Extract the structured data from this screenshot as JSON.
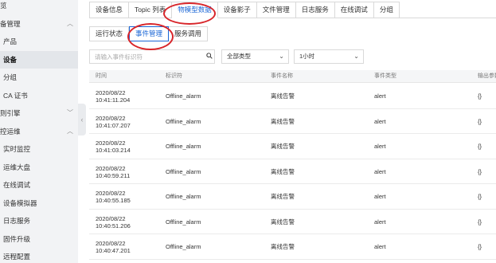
{
  "sidebar": {
    "items": [
      {
        "label": "览",
        "level": "l1",
        "chevron": ""
      },
      {
        "label": "备管理",
        "level": "l1",
        "chevron": "^"
      },
      {
        "label": "产品",
        "level": "l2",
        "chevron": ""
      },
      {
        "label": "设备",
        "level": "l2",
        "chevron": "",
        "active": true
      },
      {
        "label": "分组",
        "level": "l2",
        "chevron": ""
      },
      {
        "label": "CA 证书",
        "level": "l2",
        "chevron": ""
      },
      {
        "label": "则引擎",
        "level": "l1",
        "chevron": "v"
      },
      {
        "label": "控运维",
        "level": "l1",
        "chevron": "^"
      },
      {
        "label": "实时监控",
        "level": "l2",
        "chevron": ""
      },
      {
        "label": "运维大盘",
        "level": "l2",
        "chevron": ""
      },
      {
        "label": "在线调试",
        "level": "l2",
        "chevron": ""
      },
      {
        "label": "设备模拟器",
        "level": "l2",
        "chevron": ""
      },
      {
        "label": "日志服务",
        "level": "l2",
        "chevron": ""
      },
      {
        "label": "固件升级",
        "level": "l2",
        "chevron": ""
      },
      {
        "label": "远程配置",
        "level": "l2",
        "chevron": ""
      }
    ]
  },
  "tabs": [
    {
      "label": "设备信息"
    },
    {
      "label": "Topic 列表"
    },
    {
      "label": "物模型数据",
      "active": true
    },
    {
      "label": "设备影子"
    },
    {
      "label": "文件管理"
    },
    {
      "label": "日志服务"
    },
    {
      "label": "在线调试"
    },
    {
      "label": "分组"
    }
  ],
  "subtabs": [
    {
      "label": "运行状态"
    },
    {
      "label": "事件管理",
      "active": true
    },
    {
      "label": "服务调用"
    }
  ],
  "filters": {
    "search_placeholder": "请输入事件标识符",
    "type_select": "全部类型",
    "time_select": "1小时"
  },
  "table": {
    "headers": [
      "时间",
      "标识符",
      "事件名称",
      "事件类型",
      "输出参数"
    ],
    "rows": [
      {
        "date": "2020/08/22",
        "time": "10:41:11.204",
        "id": "Offline_alarm",
        "name": "离线告警",
        "type": "alert",
        "out": "{}"
      },
      {
        "date": "2020/08/22",
        "time": "10:41:07.207",
        "id": "Offline_alarm",
        "name": "离线告警",
        "type": "alert",
        "out": "{}"
      },
      {
        "date": "2020/08/22",
        "time": "10:41:03.214",
        "id": "Offline_alarm",
        "name": "离线告警",
        "type": "alert",
        "out": "{}"
      },
      {
        "date": "2020/08/22",
        "time": "10:40:59.211",
        "id": "Offline_alarm",
        "name": "离线告警",
        "type": "alert",
        "out": "{}"
      },
      {
        "date": "2020/08/22",
        "time": "10:40:55.185",
        "id": "Offline_alarm",
        "name": "离线告警",
        "type": "alert",
        "out": "{}"
      },
      {
        "date": "2020/08/22",
        "time": "10:40:51.206",
        "id": "Offline_alarm",
        "name": "离线告警",
        "type": "alert",
        "out": "{}"
      },
      {
        "date": "2020/08/22",
        "time": "10:40:47.201",
        "id": "Offline_alarm",
        "name": "离线告警",
        "type": "alert",
        "out": "{}"
      }
    ]
  },
  "colors": {
    "accent": "#1a66d6",
    "annotation": "#d8252a"
  }
}
